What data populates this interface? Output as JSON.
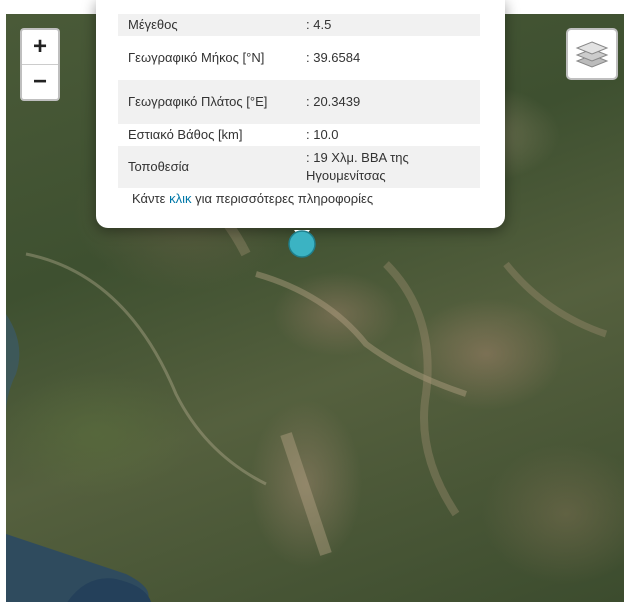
{
  "popup": {
    "rows": [
      {
        "label": "Μέγεθος",
        "value": ": 4.5"
      },
      {
        "label": "Γεωγραφικό Μήκος [°N]",
        "value": ": 39.6584"
      },
      {
        "label": "Γεωγραφικό Πλάτος [°E]",
        "value": ": 20.3439"
      },
      {
        "label": "Εστιακό Βάθος [km]",
        "value": ": 10.0"
      },
      {
        "label": "Τοποθεσία",
        "value": ": 19 Χλμ. ΒΒΑ της Ηγουμενίτσας"
      }
    ],
    "more_prefix": "Κάντε",
    "more_link": "κλικ",
    "more_suffix": "για περισσότερες πληροφορίες"
  },
  "zoom": {
    "in_label": "+",
    "out_label": "−"
  },
  "icons": {
    "layers": "layers-icon",
    "marker": "earthquake-marker-icon"
  },
  "colors": {
    "marker": "#3bb3c3",
    "link": "#0078a8"
  }
}
